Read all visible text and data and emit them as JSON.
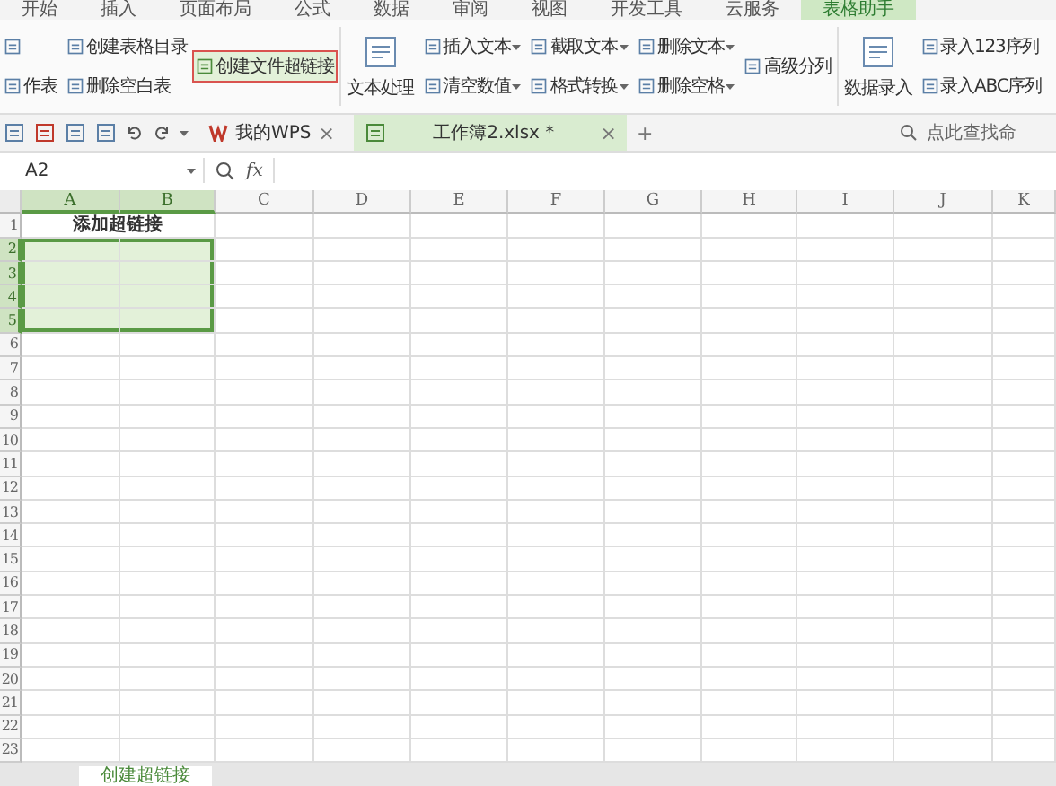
{
  "menu_tabs": [
    {
      "label": "开始",
      "selected": false
    },
    {
      "label": "插入",
      "selected": false
    },
    {
      "label": "页面布局",
      "selected": false
    },
    {
      "label": "公式",
      "selected": false
    },
    {
      "label": "数据",
      "selected": false
    },
    {
      "label": "审阅",
      "selected": false
    },
    {
      "label": "视图",
      "selected": false
    },
    {
      "label": "开发工具",
      "selected": false
    },
    {
      "label": "云服务",
      "selected": false
    },
    {
      "label": "表格助手",
      "selected": true
    }
  ],
  "ribbon": [
    {
      "kind": "stack",
      "items": [
        {
          "dropdown": false,
          "highlighted": false
        },
        {
          "label": "作表",
          "dropdown": false,
          "highlighted": false
        }
      ]
    },
    {
      "kind": "stack",
      "items": [
        {
          "label": "创建表格目录",
          "dropdown": false,
          "highlighted": false
        },
        {
          "label": "删除空白表",
          "dropdown": false,
          "highlighted": false
        }
      ]
    },
    {
      "kind": "stack",
      "items": [
        {
          "label": "创建文件超链接",
          "dropdown": false,
          "highlighted": true
        }
      ]
    },
    {
      "kind": "separator"
    },
    {
      "kind": "large",
      "label": "文本处理"
    },
    {
      "kind": "stack",
      "items": [
        {
          "label": "插入文本",
          "dropdown": true,
          "highlighted": false
        },
        {
          "label": "清空数值",
          "dropdown": true,
          "highlighted": false
        }
      ]
    },
    {
      "kind": "stack",
      "items": [
        {
          "label": "截取文本",
          "dropdown": true,
          "highlighted": false
        },
        {
          "label": "格式转换",
          "dropdown": true,
          "highlighted": false
        }
      ]
    },
    {
      "kind": "stack",
      "items": [
        {
          "label": "删除文本",
          "dropdown": true,
          "highlighted": false
        },
        {
          "label": "删除空格",
          "dropdown": true,
          "highlighted": false
        }
      ]
    },
    {
      "kind": "stack",
      "items": [
        {
          "label": "高级分列",
          "dropdown": false,
          "highlighted": false
        }
      ]
    },
    {
      "kind": "separator"
    },
    {
      "kind": "large",
      "label": "数据录入"
    },
    {
      "kind": "stack",
      "items": [
        {
          "label": "录入123序列",
          "dropdown": false,
          "highlighted": false
        },
        {
          "label": "录入ABC序列",
          "dropdown": false,
          "highlighted": false
        }
      ]
    }
  ],
  "doc_tabs": [
    {
      "label": "我的WPS",
      "close": "×",
      "selected": false,
      "kind": "home"
    },
    {
      "label": "工作簿2.xlsx *",
      "close": "×",
      "selected": true,
      "kind": "sheet"
    }
  ],
  "new_tab": "+",
  "search": {
    "placeholder": "点此查找命"
  },
  "formula_bar": {
    "cell": "A2",
    "fx": "fx"
  },
  "sheet": {
    "columns": [
      {
        "label": "A",
        "selected": true
      },
      {
        "label": "B",
        "selected": true
      },
      {
        "label": "C",
        "selected": false
      },
      {
        "label": "D",
        "selected": false
      },
      {
        "label": "E",
        "selected": false
      },
      {
        "label": "F",
        "selected": false
      },
      {
        "label": "G",
        "selected": false
      },
      {
        "label": "H",
        "selected": false
      },
      {
        "label": "I",
        "selected": false
      },
      {
        "label": "J",
        "selected": false
      },
      {
        "label": "K",
        "selected": false
      }
    ],
    "rows": [
      {
        "label": "1",
        "selected": false
      },
      {
        "label": "2",
        "selected": true
      },
      {
        "label": "3",
        "selected": true
      },
      {
        "label": "4",
        "selected": true
      },
      {
        "label": "5",
        "selected": true
      },
      {
        "label": "6",
        "selected": false
      },
      {
        "label": "7",
        "selected": false
      },
      {
        "label": "8",
        "selected": false
      },
      {
        "label": "9",
        "selected": false
      },
      {
        "label": "10",
        "selected": false
      },
      {
        "label": "11",
        "selected": false
      },
      {
        "label": "12",
        "selected": false
      },
      {
        "label": "13",
        "selected": false
      },
      {
        "label": "14",
        "selected": false
      },
      {
        "label": "15",
        "selected": false
      },
      {
        "label": "16",
        "selected": false
      },
      {
        "label": "17",
        "selected": false
      },
      {
        "label": "18",
        "selected": false
      },
      {
        "label": "19",
        "selected": false
      },
      {
        "label": "20",
        "selected": false
      },
      {
        "label": "21",
        "selected": false
      },
      {
        "label": "22",
        "selected": false
      },
      {
        "label": "23",
        "selected": false
      }
    ],
    "title_cell": "添加超链接"
  },
  "sheet_tabs": [
    {
      "label": "创建超链接",
      "selected": true
    }
  ]
}
